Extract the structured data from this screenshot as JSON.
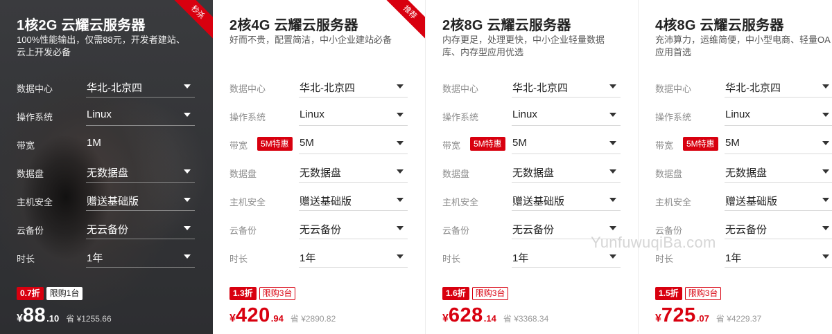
{
  "cards": [
    {
      "title": "1核2G 云耀云服务器",
      "desc": "100%性能输出，仅需88元，开发者建站、云上开发必备",
      "ribbon": "秒杀",
      "rows": [
        {
          "label": "数据中心",
          "value": "华北-北京四",
          "dropdown": true
        },
        {
          "label": "操作系统",
          "value": "Linux",
          "dropdown": true
        },
        {
          "label": "带宽",
          "value": "1M",
          "dropdown": false
        },
        {
          "label": "数据盘",
          "value": "无数据盘",
          "dropdown": true
        },
        {
          "label": "主机安全",
          "value": "赠送基础版",
          "dropdown": true
        },
        {
          "label": "云备份",
          "value": "无云备份",
          "dropdown": true
        },
        {
          "label": "时长",
          "value": "1年",
          "dropdown": true
        }
      ],
      "discount": "0.7折",
      "limit": "限购1台",
      "currency": "¥",
      "price_int": "88",
      "price_dec": ".10",
      "save": "省 ¥1255.66"
    },
    {
      "title": "2核4G 云耀云服务器",
      "desc": "好而不贵，配置简洁，中小企业建站必备",
      "ribbon": "推荐",
      "rows": [
        {
          "label": "数据中心",
          "value": "华北-北京四",
          "dropdown": true
        },
        {
          "label": "操作系统",
          "value": "Linux",
          "dropdown": true
        },
        {
          "label": "带宽",
          "badge": "5M特惠",
          "value": "5M",
          "dropdown": true
        },
        {
          "label": "数据盘",
          "value": "无数据盘",
          "dropdown": true
        },
        {
          "label": "主机安全",
          "value": "赠送基础版",
          "dropdown": true
        },
        {
          "label": "云备份",
          "value": "无云备份",
          "dropdown": true
        },
        {
          "label": "时长",
          "value": "1年",
          "dropdown": true
        }
      ],
      "discount": "1.3折",
      "limit": "限购3台",
      "currency": "¥",
      "price_int": "420",
      "price_dec": ".94",
      "save": "省 ¥2890.82"
    },
    {
      "title": "2核8G 云耀云服务器",
      "desc": "内存更足，处理更快，中小企业轻量数据库、内存型应用优选",
      "rows": [
        {
          "label": "数据中心",
          "value": "华北-北京四",
          "dropdown": true
        },
        {
          "label": "操作系统",
          "value": "Linux",
          "dropdown": true
        },
        {
          "label": "带宽",
          "badge": "5M特惠",
          "value": "5M",
          "dropdown": true
        },
        {
          "label": "数据盘",
          "value": "无数据盘",
          "dropdown": true
        },
        {
          "label": "主机安全",
          "value": "赠送基础版",
          "dropdown": true
        },
        {
          "label": "云备份",
          "value": "无云备份",
          "dropdown": true
        },
        {
          "label": "时长",
          "value": "1年",
          "dropdown": true
        }
      ],
      "discount": "1.6折",
      "limit": "限购3台",
      "currency": "¥",
      "price_int": "628",
      "price_dec": ".14",
      "save": "省 ¥3368.34"
    },
    {
      "title": "4核8G 云耀云服务器",
      "desc": "充沛算力，运维简便，中小型电商、轻量OA应用首选",
      "rows": [
        {
          "label": "数据中心",
          "value": "华北-北京四",
          "dropdown": true
        },
        {
          "label": "操作系统",
          "value": "Linux",
          "dropdown": true
        },
        {
          "label": "带宽",
          "badge": "5M特惠",
          "value": "5M",
          "dropdown": true
        },
        {
          "label": "数据盘",
          "value": "无数据盘",
          "dropdown": true
        },
        {
          "label": "主机安全",
          "value": "赠送基础版",
          "dropdown": true
        },
        {
          "label": "云备份",
          "value": "无云备份",
          "dropdown": true
        },
        {
          "label": "时长",
          "value": "1年",
          "dropdown": true
        }
      ],
      "discount": "1.5折",
      "limit": "限购3台",
      "currency": "¥",
      "price_int": "725",
      "price_dec": ".07",
      "save": "省 ¥4229.37"
    }
  ],
  "watermark": "YunfuwuqiBa.com",
  "colors": {
    "accent": "#d8000f",
    "dark_card": "#333437",
    "label_gray": "#8c8c8c",
    "text": "#222222"
  },
  "icons": {
    "dropdown": "caret-down-icon"
  }
}
